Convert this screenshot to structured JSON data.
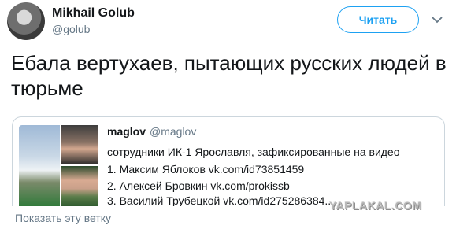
{
  "author": {
    "name": "Mikhail Golub",
    "handle": "@golub"
  },
  "follow_button_label": "Читать",
  "more_icon": "chevron-down-icon",
  "tweet": {
    "text": "Ебала вертухаев, пытающих русских людей в тюрьме"
  },
  "quote": {
    "name": "maglov",
    "handle": "@maglov",
    "lines": [
      "сотрудники ИК-1 Ярославля, зафиксированные на видео",
      "1. Максим Яблоков vk.com/id73851459",
      "2. Алексей Бровкин vk.com/prokissb",
      "3. Василий Трубецкой vk.com/id275286384..."
    ]
  },
  "show_thread_label": "Показать эту ветку",
  "watermark": "YAPLAKAL.COM",
  "colors": {
    "accent": "#1da1f2",
    "muted": "#657786",
    "text": "#14171a",
    "border": "#ccd6dd"
  }
}
